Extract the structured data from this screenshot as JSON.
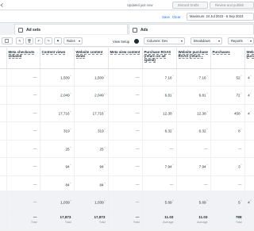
{
  "topbar": {
    "updated_text": "Updated just now",
    "discard_label": "Discard Drafts",
    "review_label": "Review and publish"
  },
  "filterbar": {
    "save_label": "Save",
    "clear_label": "Clear",
    "date_range": "Maximum: 24 Jul 2023 - 6 Sep 2023"
  },
  "tabs": {
    "adsets_label": "Ad sets",
    "ads_label": "Ads"
  },
  "toolbar": {
    "rules_label": "Rules",
    "view_setup_label": "View Setup",
    "columns_label": "Columns: Dev",
    "breakdown_label": "Breakdown",
    "reports_label": "Reports"
  },
  "table": {
    "headers": [
      "Meta checkouts initiated",
      "Content views",
      "Website content views",
      "Meta view content",
      "Purchase ROAS (return on ad spend)",
      "Website purchase ROAS (return...",
      "Purchases",
      "Web purc"
    ],
    "rows": [
      [
        "—",
        "1,509",
        "1,509",
        "—",
        "7.16",
        "7.16",
        "52",
        "4"
      ],
      [
        "—",
        "2,049",
        "2,049",
        "—",
        "6.81",
        "6.81",
        "72",
        "4"
      ],
      [
        "—",
        "17,716",
        "17,716",
        "—",
        "12.38",
        "12.38",
        "458",
        "4"
      ],
      [
        "—",
        "319",
        "319",
        "—",
        "6.32",
        "6.32",
        "8",
        ""
      ],
      [
        "—",
        "25",
        "25",
        "—",
        "—",
        "—",
        "—",
        ""
      ],
      [
        "—",
        "94",
        "94",
        "—",
        "7.94",
        "7.94",
        "3",
        ""
      ],
      [
        "—",
        "84",
        "84",
        "—",
        "—",
        "—",
        "—",
        ""
      ],
      [
        "—",
        "1,039",
        "1,039",
        "—",
        "5.69",
        "5.69",
        "5",
        "4"
      ]
    ],
    "totals": [
      "—",
      "17,873",
      "17,873",
      "—",
      "11.03",
      "11.03",
      "788",
      ""
    ],
    "total_sublabels": [
      "Total",
      "Total",
      "Total",
      "Total",
      "Average",
      "Average",
      "Total",
      ""
    ]
  }
}
